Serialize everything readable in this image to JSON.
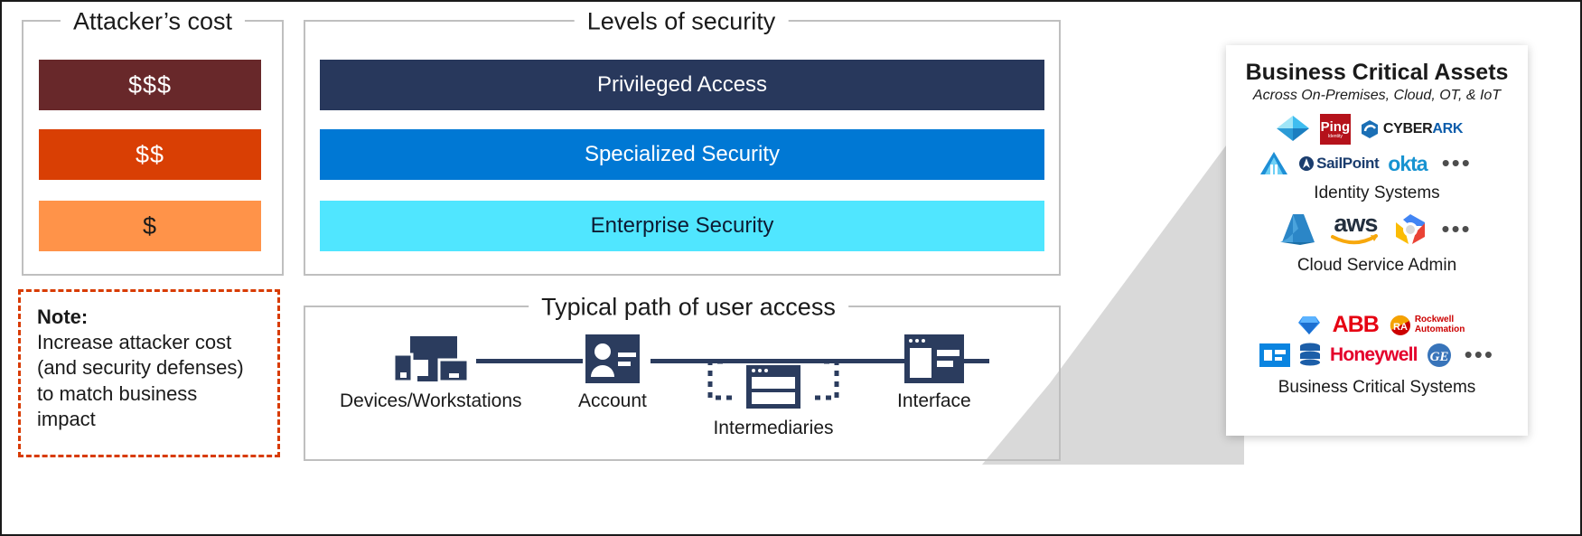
{
  "attacker_cost": {
    "title": "Attacker’s cost",
    "bars": [
      {
        "label": "$$$",
        "color": "#68282a",
        "text_color": "#ffffff"
      },
      {
        "label": "$$",
        "color": "#d93f04",
        "text_color": "#ffffff"
      },
      {
        "label": "$",
        "color": "#ff9349",
        "text_color": "#1a1a1a"
      }
    ]
  },
  "note": {
    "title": "Note:",
    "body": "Increase attacker cost (and security defenses) to match business impact",
    "border_color": "#d83b01"
  },
  "levels_of_security": {
    "title": "Levels of security",
    "bars": [
      {
        "label": "Privileged Access",
        "color": "#28385c",
        "text_color": "#ffffff"
      },
      {
        "label": "Specialized Security",
        "color": "#0078d4",
        "text_color": "#ffffff"
      },
      {
        "label": "Enterprise Security",
        "color": "#50e6ff",
        "text_color": "#0d1b33"
      }
    ]
  },
  "access_path": {
    "title": "Typical path of user access",
    "nodes": [
      {
        "label": "Devices/Workstations",
        "icon": "devices-icon"
      },
      {
        "label": "Account",
        "icon": "account-badge-icon"
      },
      {
        "label": "Intermediaries",
        "icon": "intermediaries-icon"
      },
      {
        "label": "Interface",
        "icon": "interface-window-icon"
      }
    ],
    "icon_color": "#2b3c5e"
  },
  "business_critical_assets": {
    "title": "Business Critical Assets",
    "subtitle": "Across On-Premises, Cloud, OT, & IoT",
    "groups": [
      {
        "label": "Identity Systems",
        "row1": [
          "azure-ad-icon",
          "ping-identity-logo",
          "cyberark-logo"
        ],
        "row1_text": [
          "",
          "Ping",
          "CYBERARK"
        ],
        "row2": [
          "active-directory-icon",
          "sailpoint-logo",
          "okta-logo"
        ],
        "row2_text": [
          "",
          "SailPoint",
          "okta"
        ],
        "ellipsis": "•••"
      },
      {
        "label": "Cloud Service Admin",
        "row1": [
          "azure-logo",
          "aws-logo",
          "google-cloud-logo"
        ],
        "row1_text": [
          "",
          "aws",
          ""
        ],
        "ellipsis": "•••"
      },
      {
        "label": "Business Critical Systems",
        "row1": [
          "sap-gem-icon",
          "abb-logo",
          "rockwell-automation-logo"
        ],
        "row1_text": [
          "",
          "ABB",
          "Rockwell Automation"
        ],
        "row2": [
          "vm-app-icon",
          "database-stack-icon",
          "honeywell-logo",
          "ge-logo"
        ],
        "row2_text": [
          "",
          "",
          "Honeywell",
          "GE"
        ],
        "ellipsis": "•••"
      }
    ]
  },
  "rockwell": {
    "line1": "Rockwell",
    "line2": "Automation"
  },
  "ping": {
    "name": "Ping",
    "sub": "Identity"
  },
  "cyberark": {
    "part1": "CYBER",
    "part2": "ARK"
  },
  "colors": {
    "frame_border": "#bfbfbf",
    "wedge": "#d9d9d9",
    "icon_navy": "#2b3c5e"
  }
}
